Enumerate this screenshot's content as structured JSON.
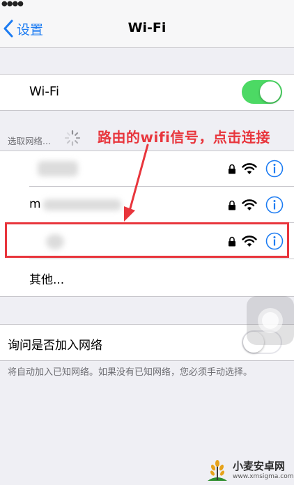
{
  "status_bar": {
    "signal": "●●●●"
  },
  "nav": {
    "back_label": "设置",
    "title": "Wi-Fi"
  },
  "wifi": {
    "label": "Wi-Fi",
    "enabled": true
  },
  "networks_section": {
    "label": "选取网络...",
    "rows": [
      {
        "name": "",
        "secured": true
      },
      {
        "name": "m",
        "secured": true
      },
      {
        "name": "",
        "secured": true
      }
    ],
    "other_label": "其他..."
  },
  "ask_join": {
    "label": "询问是否加入网络",
    "enabled": false,
    "footnote": "将自动加入已知网络。如果没有已知网络，您必须手动选择。"
  },
  "annotation": {
    "text": "路由的wifi信号，点击连接",
    "color": "#e8353c"
  },
  "watermark": {
    "title": "小麦安卓网",
    "url": "www.xmsigma.com"
  },
  "colors": {
    "accent": "#1d7cf2",
    "toggle_on": "#4cd964",
    "highlight": "#e8353c",
    "background": "#efeff4"
  },
  "icons": [
    "chevron-left-icon",
    "spinner-icon",
    "lock-icon",
    "wifi-signal-icon",
    "info-icon"
  ]
}
